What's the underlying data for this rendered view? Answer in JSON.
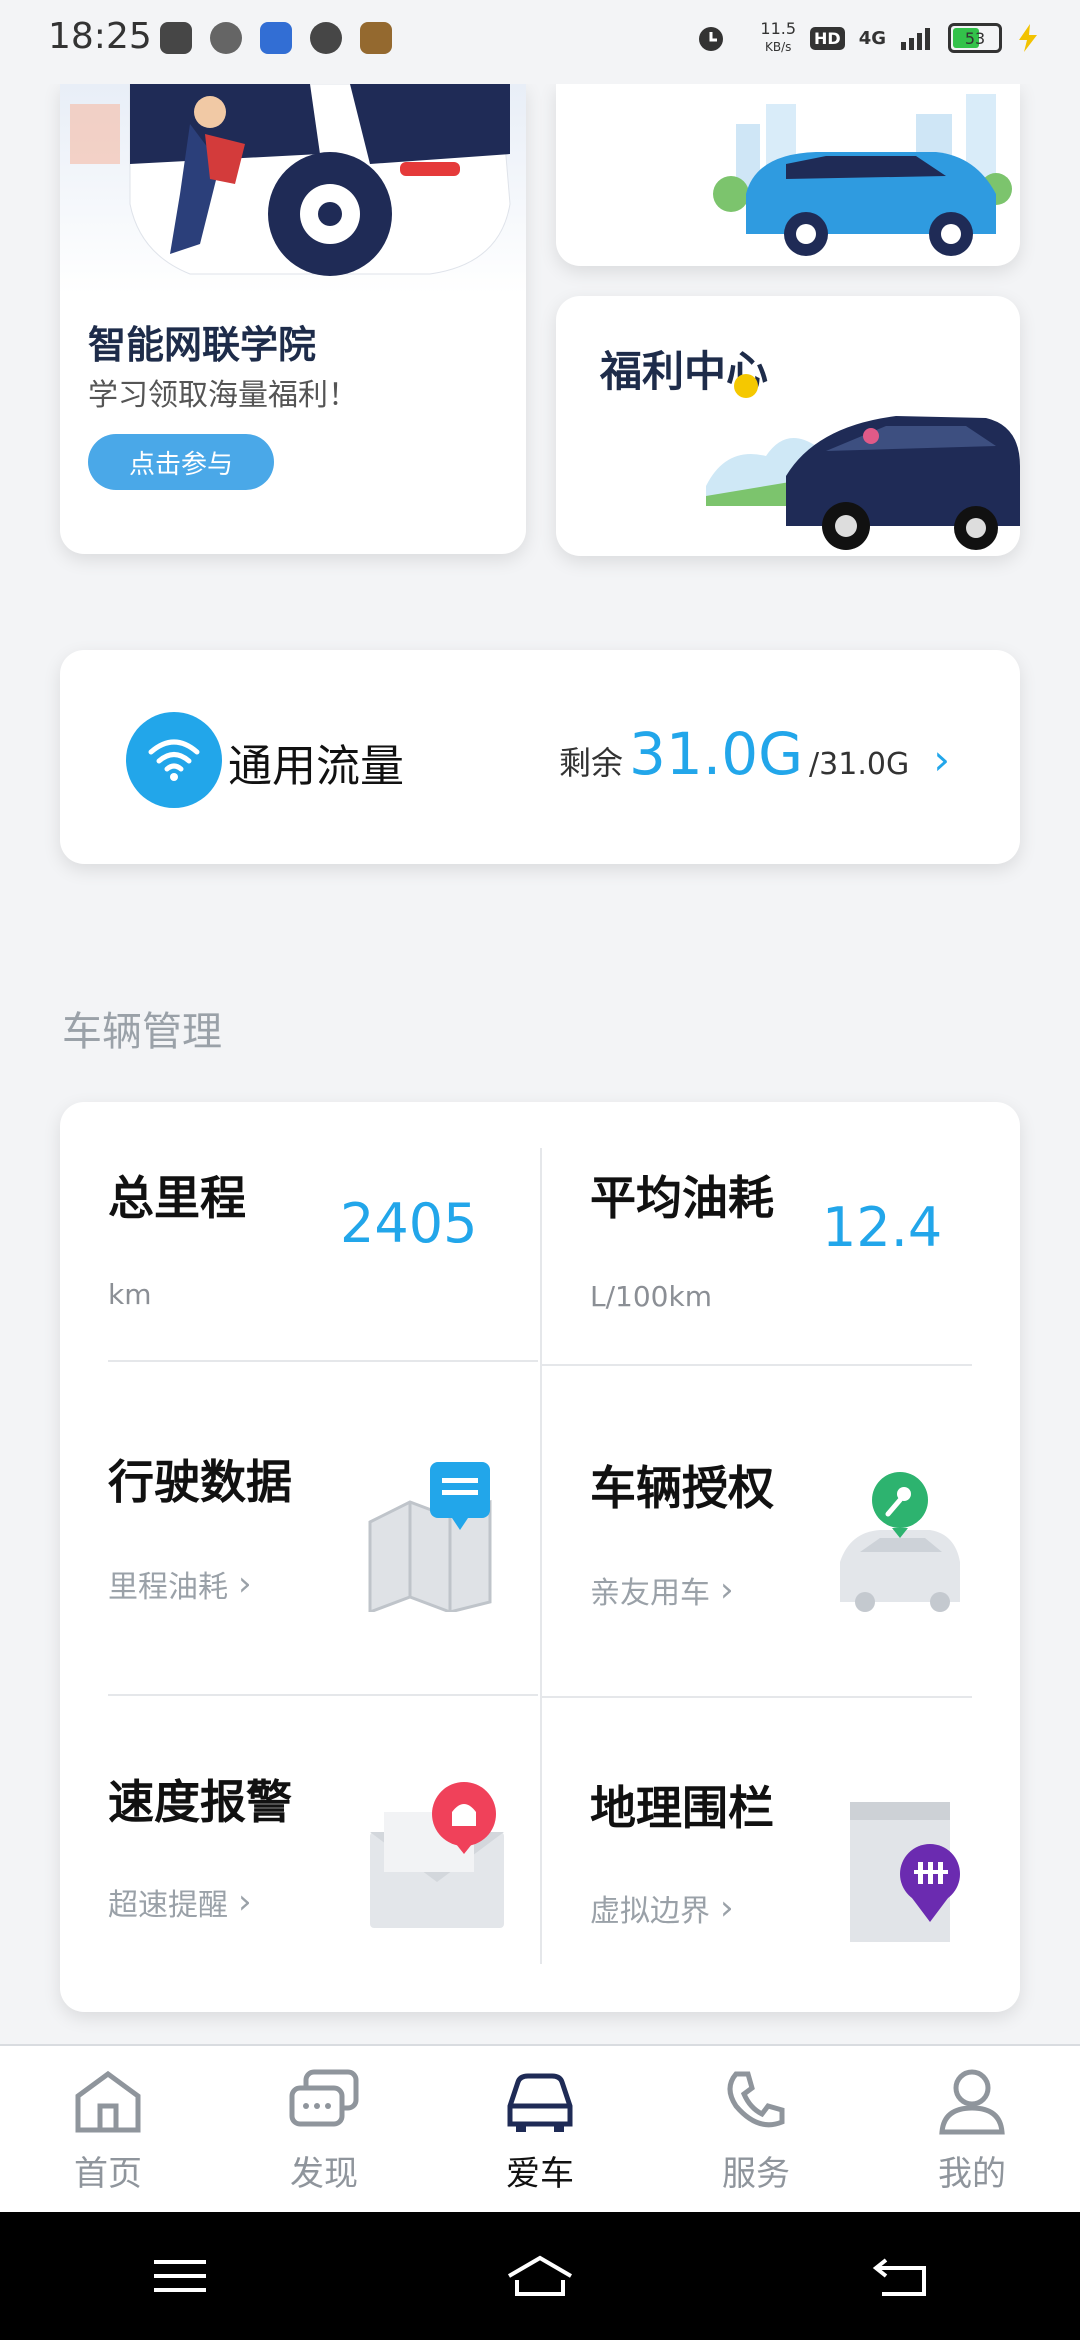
{
  "status": {
    "time": "18:25",
    "speed": "11.5",
    "speed_unit": "KB/s",
    "hd": "HD",
    "network": "4G",
    "battery": "53"
  },
  "promos": [
    {
      "title": "智能网联学院",
      "subtitle": "学习领取海量福利！",
      "button": "点击参与"
    },
    {
      "title": "福利中心"
    }
  ],
  "data_plan": {
    "label": "通用流量",
    "remain_prefix": "剩余",
    "remain_value": "31.0G",
    "remain_total": "/31.0G"
  },
  "section_title": "车辆管理",
  "vehicle": {
    "total_mileage": {
      "title": "总里程",
      "value": "2405",
      "unit": "km"
    },
    "avg_fuel": {
      "title": "平均油耗",
      "value": "12.4",
      "unit": "L/100km"
    },
    "tiles": [
      {
        "title": "行驶数据",
        "link": "里程油耗"
      },
      {
        "title": "车辆授权",
        "link": "亲友用车"
      },
      {
        "title": "速度报警",
        "link": "超速提醒"
      },
      {
        "title": "地理围栏",
        "link": "虚拟边界"
      }
    ]
  },
  "tabbar": [
    {
      "label": "首页"
    },
    {
      "label": "发现"
    },
    {
      "label": "爱车"
    },
    {
      "label": "服务"
    },
    {
      "label": "我的"
    }
  ],
  "colors": {
    "accent": "#22a6ea",
    "promo_button": "#4aa8e8",
    "text_dark": "#1e2c4a"
  }
}
